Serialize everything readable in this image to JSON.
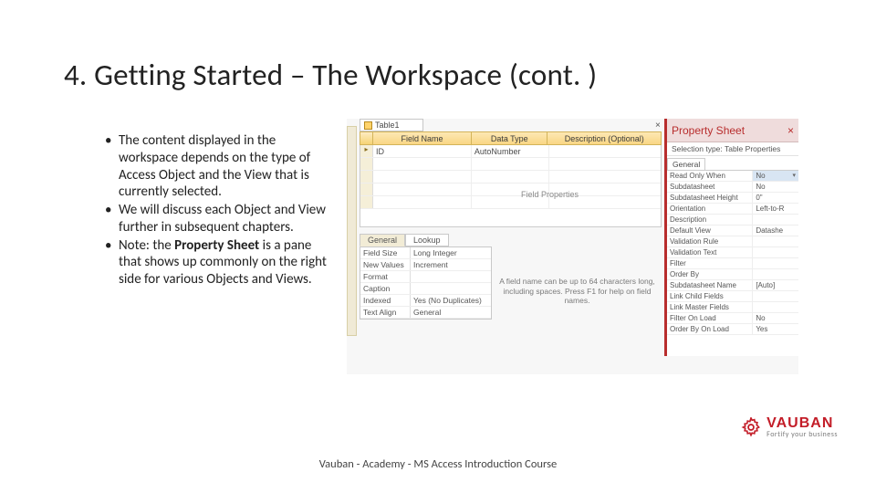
{
  "title": "4. Getting Started – The Workspace (cont. )",
  "bullets": {
    "b1": "The content displayed in the workspace depends on the type of Access Object and the View that is currently selected.",
    "b2": "We will discuss each Object and View further in subsequent chapters.",
    "b3_pre": "Note: the ",
    "b3_bold": "Property Sheet",
    "b3_post": " is a pane that shows up commonly on the right side for various Objects and Views."
  },
  "mock": {
    "tab": "Table1",
    "close": "×",
    "columns": {
      "c1": "Field Name",
      "c2": "Data Type",
      "c3": "Description (Optional)"
    },
    "marker": "▸",
    "row1": {
      "name": "ID",
      "type": "AutoNumber",
      "desc": ""
    },
    "hint1": "Field Properties",
    "hint2": "A field name can be up to 64 characters long, including spaces. Press F1 for help on field names.",
    "tabs2": {
      "t1": "General",
      "t2": "Lookup"
    },
    "lower": [
      {
        "k": "Field Size",
        "v": "Long Integer"
      },
      {
        "k": "New Values",
        "v": "Increment"
      },
      {
        "k": "Format",
        "v": ""
      },
      {
        "k": "Caption",
        "v": ""
      },
      {
        "k": "Indexed",
        "v": "Yes (No Duplicates)"
      },
      {
        "k": "Text Align",
        "v": "General"
      }
    ],
    "psheet": {
      "title": "Property Sheet",
      "subtitle": "Selection type: Table Properties",
      "gtab": "General",
      "rows": [
        {
          "k": "Read Only When Disconnected",
          "v": "No",
          "sel": true
        },
        {
          "k": "Subdatasheet Expanded",
          "v": "No"
        },
        {
          "k": "Subdatasheet Height",
          "v": "0\""
        },
        {
          "k": "Orientation",
          "v": "Left-to-R"
        },
        {
          "k": "Description",
          "v": ""
        },
        {
          "k": "Default View",
          "v": "Datashe"
        },
        {
          "k": "Validation Rule",
          "v": ""
        },
        {
          "k": "Validation Text",
          "v": ""
        },
        {
          "k": "Filter",
          "v": ""
        },
        {
          "k": "Order By",
          "v": ""
        },
        {
          "k": "Subdatasheet Name",
          "v": "[Auto]"
        },
        {
          "k": "Link Child Fields",
          "v": ""
        },
        {
          "k": "Link Master Fields",
          "v": ""
        },
        {
          "k": "Filter On Load",
          "v": "No"
        },
        {
          "k": "Order By On Load",
          "v": "Yes"
        }
      ]
    }
  },
  "logo": {
    "brand": "VAUBAN",
    "tagline": "Fortify your business"
  },
  "footer": "Vauban - Academy - MS Access Introduction Course"
}
